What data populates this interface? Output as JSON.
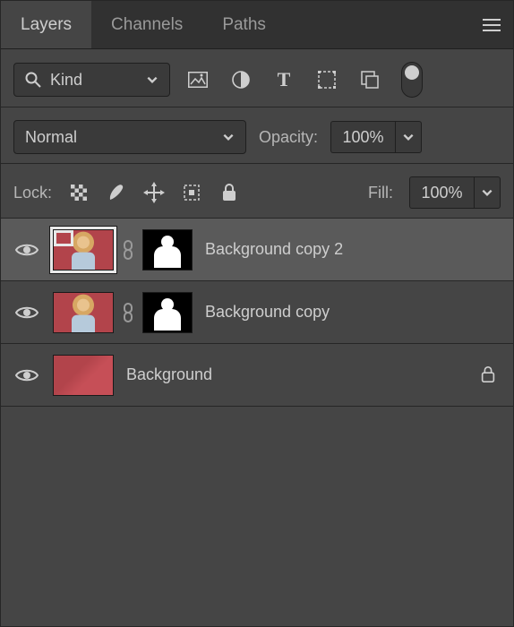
{
  "tabs": {
    "items": [
      {
        "label": "Layers",
        "active": true
      },
      {
        "label": "Channels",
        "active": false
      },
      {
        "label": "Paths",
        "active": false
      }
    ]
  },
  "filter": {
    "kind_label": "Kind"
  },
  "blend": {
    "mode": "Normal",
    "opacity_label": "Opacity:",
    "opacity_value": "100%"
  },
  "lock": {
    "label": "Lock:",
    "fill_label": "Fill:",
    "fill_value": "100%"
  },
  "layers": [
    {
      "name": "Background copy 2",
      "visible": true,
      "has_mask": true,
      "locked": false,
      "selected": true,
      "bg_only": false
    },
    {
      "name": "Background copy",
      "visible": true,
      "has_mask": true,
      "locked": false,
      "selected": false,
      "bg_only": false
    },
    {
      "name": "Background",
      "visible": true,
      "has_mask": false,
      "locked": true,
      "selected": false,
      "bg_only": true
    }
  ],
  "icons": {
    "panel_menu": "panel-menu-icon",
    "search": "search-icon",
    "pixel": "pixel-layer-icon",
    "adjust": "adjustment-layer-icon",
    "type": "type-layer-icon",
    "shape": "shape-layer-icon",
    "smart": "smart-object-icon",
    "lock_trans": "lock-transparency-icon",
    "lock_brush": "lock-pixels-icon",
    "lock_move": "lock-position-icon",
    "lock_art": "lock-artboard-icon",
    "lock_all": "lock-all-icon",
    "visibility": "visibility-icon",
    "link": "link-icon"
  }
}
